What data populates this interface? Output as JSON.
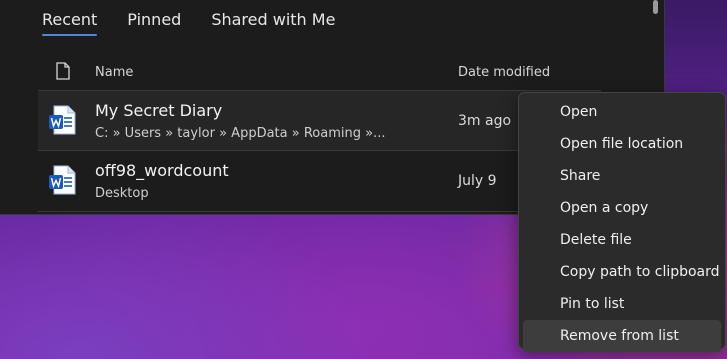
{
  "tabs": [
    {
      "label": "Recent",
      "active": true
    },
    {
      "label": "Pinned",
      "active": false
    },
    {
      "label": "Shared with Me",
      "active": false
    }
  ],
  "columns": {
    "name": "Name",
    "date_modified": "Date modified"
  },
  "files": [
    {
      "title": "My Secret Diary",
      "path": "C: » Users » taylor » AppData » Roaming »...",
      "date": "3m ago",
      "icon": "word-doc-icon"
    },
    {
      "title": "off98_wordcount",
      "path": "Desktop",
      "date": "July 9",
      "icon": "word-doc-icon"
    }
  ],
  "context_menu": {
    "items": [
      "Open",
      "Open file location",
      "Share",
      "Open a copy",
      "Delete file",
      "Copy path to clipboard",
      "Pin to list",
      "Remove from list"
    ],
    "highlighted": "Remove from list"
  },
  "colors": {
    "accent": "#4f86d9",
    "word_blue": "#185abd",
    "panel": "#1c1c1c",
    "menu": "#2b2b2b"
  }
}
